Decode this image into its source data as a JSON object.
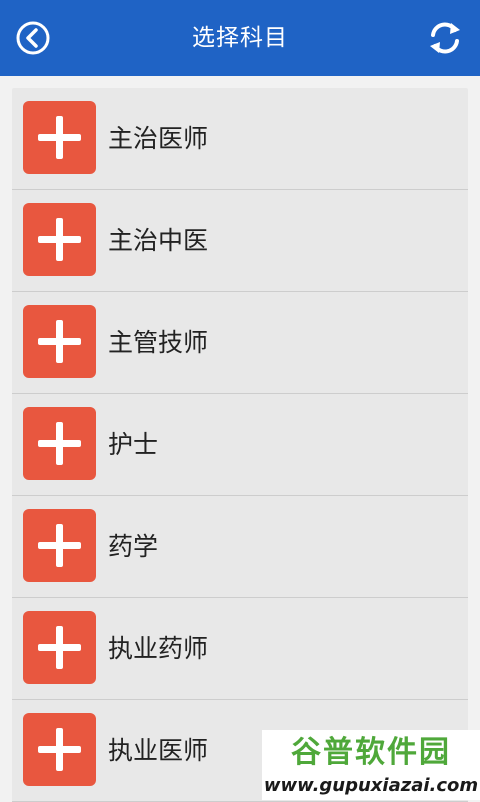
{
  "header": {
    "title": "选择科目",
    "back_icon": "back-arrow-circle-icon",
    "refresh_icon": "refresh-icon",
    "bg_color": "#1f63c5"
  },
  "subjects": [
    {
      "label": "主治医师",
      "icon": "plus-icon"
    },
    {
      "label": "主治中医",
      "icon": "plus-icon"
    },
    {
      "label": "主管技师",
      "icon": "plus-icon"
    },
    {
      "label": "护士",
      "icon": "plus-icon"
    },
    {
      "label": "药学",
      "icon": "plus-icon"
    },
    {
      "label": "执业药师",
      "icon": "plus-icon"
    },
    {
      "label": "执业医师",
      "icon": "plus-icon"
    }
  ],
  "colors": {
    "accent": "#e8573f",
    "list_bg": "#e8e8e8"
  },
  "watermark": {
    "cn": "谷普软件园",
    "en": "www.gupuxiazai.com"
  }
}
